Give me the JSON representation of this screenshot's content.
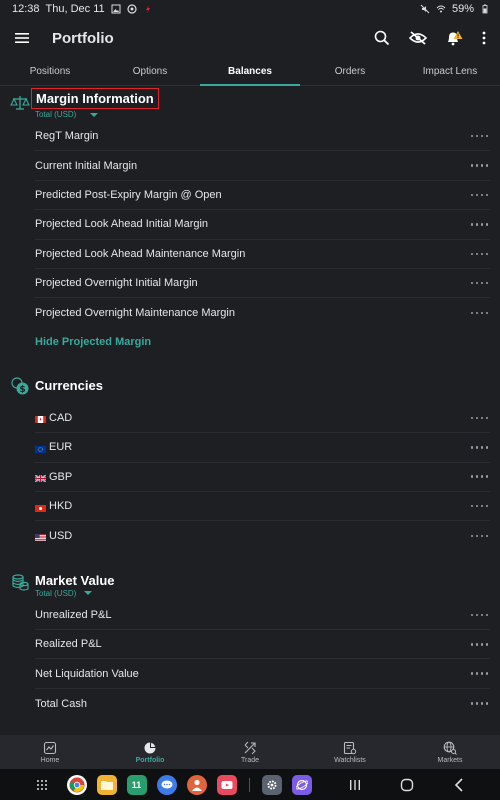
{
  "status_bar": {
    "time": "12:38",
    "date": "Thu, Dec 11",
    "battery": "59%"
  },
  "header": {
    "title": "Portfolio",
    "icons": [
      "menu-icon",
      "search-icon",
      "hide-eye-icon",
      "alert-bell-icon",
      "more-vertical-icon"
    ]
  },
  "tabs": [
    {
      "label": "Positions",
      "active": false
    },
    {
      "label": "Options",
      "active": false
    },
    {
      "label": "Balances",
      "active": true
    },
    {
      "label": "Orders",
      "active": false
    },
    {
      "label": "Impact Lens",
      "active": false
    }
  ],
  "margin": {
    "title": "Margin Information",
    "subtitle": "Total (USD)",
    "rows": [
      "RegT Margin",
      "Current Initial Margin",
      "Predicted Post-Expiry Margin @ Open",
      "Projected Look Ahead Initial Margin",
      "Projected Look Ahead Maintenance Margin",
      "Projected Overnight Initial Margin",
      "Projected Overnight Maintenance Margin"
    ],
    "link": "Hide Projected Margin"
  },
  "currencies": {
    "title": "Currencies",
    "rows": [
      "CAD",
      "EUR",
      "GBP",
      "HKD",
      "USD"
    ]
  },
  "market_value": {
    "title": "Market Value",
    "subtitle": "Total (USD)",
    "rows": [
      "Unrealized P&L",
      "Realized P&L",
      "Net Liquidation Value",
      "Total Cash"
    ]
  },
  "bottom_nav": [
    {
      "label": "Home",
      "icon": "home-chart-icon",
      "active": false
    },
    {
      "label": "Portfolio",
      "icon": "pie-chart-icon",
      "active": true
    },
    {
      "label": "Trade",
      "icon": "trade-arrows-icon",
      "active": false
    },
    {
      "label": "Watchlists",
      "icon": "watchlist-icon",
      "active": false
    },
    {
      "label": "Markets",
      "icon": "globe-search-icon",
      "active": false
    }
  ],
  "taskbar_apps": [
    {
      "name": "chrome",
      "color": "#e8e8e8"
    },
    {
      "name": "files",
      "color": "#f2b233"
    },
    {
      "name": "calendar",
      "color": "#2a9d6f",
      "text": "11"
    },
    {
      "name": "messages",
      "color": "#3d7be8"
    },
    {
      "name": "contacts",
      "color": "#e0643c"
    },
    {
      "name": "media",
      "color": "#e84a5f"
    },
    {
      "name": "settings",
      "color": "#5b6270"
    },
    {
      "name": "internet",
      "color": "#7b5ce8"
    }
  ],
  "colors": {
    "accent": "#3aa89a",
    "highlight_box": "#e0242d",
    "background": "#1d1f23"
  }
}
